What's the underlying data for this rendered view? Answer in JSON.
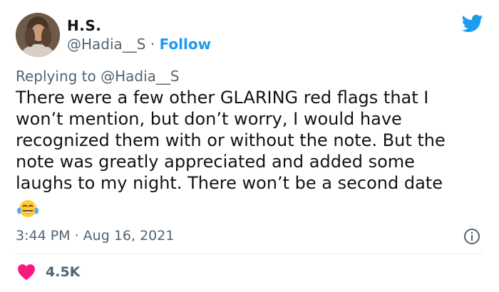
{
  "author": {
    "display_name": "H.S.",
    "handle": "@Hadia__S",
    "separator": "·",
    "follow_label": "Follow"
  },
  "reply": {
    "prefix": "Replying to",
    "target": "@Hadia__S"
  },
  "tweet": {
    "lines": [
      "There were a few other GLARING red flags that I",
      "won’t mention, but don’t worry, I would have",
      "recognized them with or without the note. But the",
      "note was greatly appreciated and added some",
      "laughs to my night. There won’t be a second date"
    ],
    "emoji": "face-with-tears-of-joy",
    "timestamp": "3:44 PM · Aug 16, 2021"
  },
  "engagement": {
    "likes": "4.5K"
  },
  "icons": {
    "brand": "twitter-bird-icon",
    "info": "info-icon",
    "like": "heart-icon"
  },
  "colors": {
    "accent": "#1d9bf0",
    "heart": "#f91880",
    "muted_text": "#536471",
    "text": "#0f1419"
  }
}
